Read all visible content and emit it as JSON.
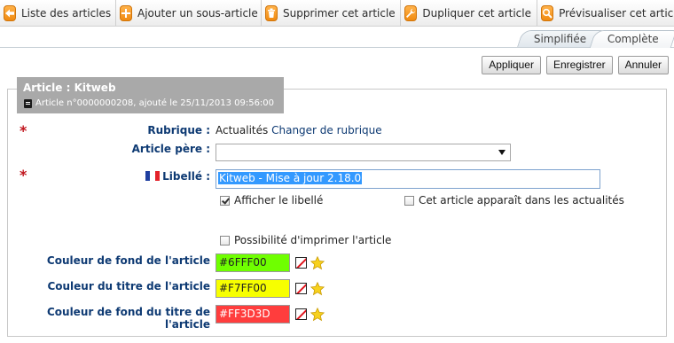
{
  "toolbar": {
    "buttons": [
      {
        "label": "Liste des articles",
        "icon": "back-arrow-icon"
      },
      {
        "label": "Ajouter un sous-article",
        "icon": "plus-icon"
      },
      {
        "label": "Supprimer cet article",
        "icon": "trash-icon"
      },
      {
        "label": "Dupliquer cet article",
        "icon": "wrench-icon"
      },
      {
        "label": "Prévisualiser cet article",
        "icon": "magnifier-icon"
      }
    ]
  },
  "tabs": [
    {
      "label": "Simplifiée",
      "active": false
    },
    {
      "label": "Complète",
      "active": true
    }
  ],
  "actions": {
    "apply": "Appliquer",
    "save": "Enregistrer",
    "cancel": "Annuler"
  },
  "header": {
    "title": "Article : Kitweb",
    "subtitle": "Article n°0000000208, ajouté le 25/11/2013 09:56:00"
  },
  "form": {
    "required_mark": "*",
    "rubrique": {
      "label": "Rubrique :",
      "value": "Actualités",
      "change_link": "Changer de rubrique"
    },
    "article_pere": {
      "label": "Article père :",
      "value": ""
    },
    "libelle": {
      "label": "Libellé :",
      "value": "Kitweb - Mise à jour 2.18.0",
      "flag_colors": [
        "#1f3fa0",
        "#ffffff",
        "#e3222a"
      ]
    },
    "afficher_libelle": {
      "label": "Afficher le libellé",
      "checked": true
    },
    "actualites": {
      "label": "Cet article apparaît dans les actualités",
      "checked": false
    },
    "imprimer": {
      "label": "Possibilité d'imprimer l'article",
      "checked": false
    },
    "couleur_fond": {
      "label": "Couleur de fond de l'article",
      "value": "#6FFF00",
      "swatch": "#6fff00"
    },
    "couleur_titre": {
      "label": "Couleur du titre de l'article",
      "value": "#F7FF00",
      "swatch": "#f7ff00"
    },
    "couleur_fond_titre": {
      "label": "Couleur de fond du titre de l'article",
      "value": "#FF3D3D",
      "swatch": "#ff3d3d"
    }
  },
  "colors": {
    "label_blue": "#0e3a73",
    "required_red": "#c0141c",
    "toolbar_icon_orange": "#f08a10",
    "header_gray": "#a9a9a9"
  }
}
